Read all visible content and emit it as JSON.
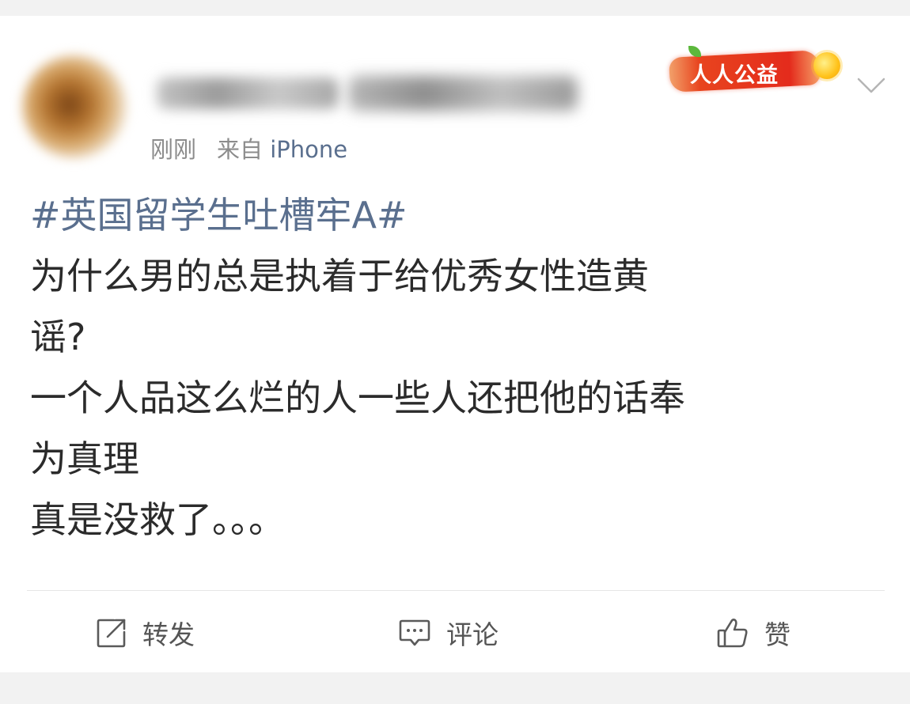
{
  "post": {
    "time": "刚刚",
    "source_prefix": "来自",
    "source_device": "iPhone",
    "badge": "人人公益",
    "hashtag": "#英国留学生吐槽牢A#",
    "text_lines": [
      "为什么男的总是执着于给优秀女性造黄",
      "谣?",
      "一个人品这么烂的人一些人还把他的话奉",
      "为真理",
      "真是没救了。。。"
    ]
  },
  "actions": {
    "repost": "转发",
    "comment": "评论",
    "like": "赞"
  },
  "icons": {
    "repost": "share-icon",
    "comment": "comment-icon",
    "like": "thumbs-up-icon",
    "menu": "chevron-down-icon",
    "badge_decoration": "sun-icon"
  },
  "colors": {
    "link": "#5a6f8e",
    "text": "#2b2b2b",
    "meta": "#8c8c8c",
    "badge": "#e42b1c"
  }
}
